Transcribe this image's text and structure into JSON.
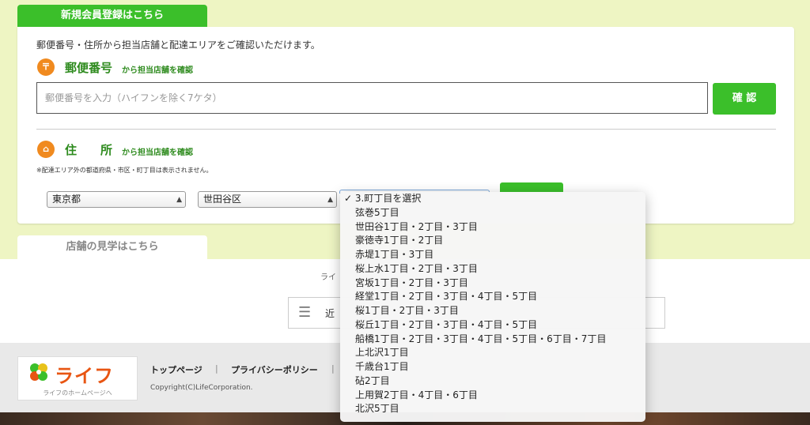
{
  "tabs": {
    "register": "新規会員登録はこちら",
    "visit": "店舗の見学はこちら"
  },
  "intro": "郵便番号・住所から担当店舗と配達エリアをご確認いただけます。",
  "postal": {
    "icon": "〒",
    "title": "郵便番号",
    "subtitle": "から担当店舗を確認",
    "placeholder": "郵便番号を入力（ハイフンを除く7ケタ）",
    "confirm_label": "確 認"
  },
  "address": {
    "icon": "⌂",
    "title": "住　　所",
    "subtitle": "から担当店舗を確認",
    "note": "※配達エリア外の都道府県・市区・町丁目は表示されません。",
    "prefecture": "東京都",
    "city": "世田谷区"
  },
  "dropdown": {
    "checkmark": "✓",
    "options": [
      "3.町丁目を選択",
      "弦巻5丁目",
      "世田谷1丁目・2丁目・3丁目",
      "豪徳寺1丁目・2丁目",
      "赤堤1丁目・3丁目",
      "桜上水1丁目・2丁目・3丁目",
      "宮坂1丁目・2丁目・3丁目",
      "経堂1丁目・2丁目・3丁目・4丁目・5丁目",
      "桜1丁目・2丁目・3丁目",
      "桜丘1丁目・2丁目・3丁目・4丁目・5丁目",
      "船橋1丁目・2丁目・3丁目・4丁目・5丁目・6丁目・7丁目",
      "上北沢1丁目",
      "千歳台1丁目",
      "砧2丁目",
      "上用賀2丁目・4丁目・6丁目",
      "北沢5丁目"
    ]
  },
  "life_text": "ライ",
  "search": {
    "text": "近"
  },
  "footer": {
    "logo_text": "ライフ",
    "logo_sub": "ライフのホームページへ",
    "links": [
      "トップページ",
      "プライバシーポリシー"
    ],
    "separator": "|",
    "copyright": "Copyright(C)LifeCorporation."
  },
  "colors": {
    "accent_green": "#3bbf2a",
    "title_green": "#2e8b1e",
    "icon_orange": "#f08a1f",
    "background": "#eef5c3"
  }
}
